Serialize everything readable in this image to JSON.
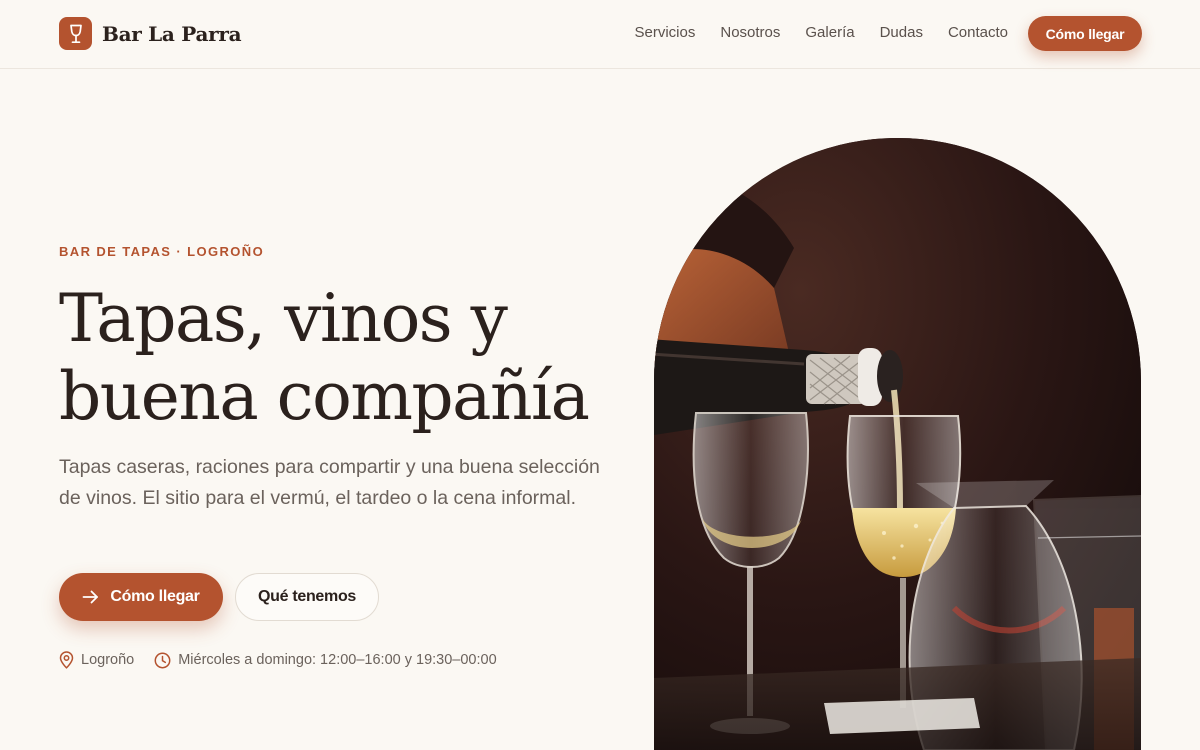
{
  "brand": {
    "name": "Bar La Parra",
    "logo_icon": "wine-glass-icon",
    "accent": "#b4532f"
  },
  "nav": {
    "items": [
      {
        "label": "Servicios"
      },
      {
        "label": "Nosotros"
      },
      {
        "label": "Galería"
      },
      {
        "label": "Dudas"
      },
      {
        "label": "Contacto"
      }
    ],
    "cta_label": "Cómo llegar"
  },
  "hero": {
    "eyebrow": "BAR DE TAPAS · LOGROÑO",
    "title_line1": "Tapas, vinos y",
    "title_line2": "buena compañía",
    "subtitle": "Tapas caseras, raciones para compartir y una buena selección de vinos. El sitio para el vermú, el tardeo o la cena informal.",
    "primary_button": {
      "label": "Cómo llegar",
      "icon": "arrow-right-icon"
    },
    "secondary_button": {
      "label": "Qué tenemos"
    },
    "location": {
      "icon": "map-pin-icon",
      "text": "Logroño"
    },
    "hours": {
      "icon": "clock-icon",
      "text": "Miércoles a domingo: 12:00–16:00 y 19:30–00:00"
    },
    "image": {
      "subject": "white wine being poured into glasses"
    }
  },
  "colors": {
    "accent": "#b4532f",
    "background": "#fbf8f3",
    "text": "#2b211d",
    "muted": "#6b625c"
  }
}
